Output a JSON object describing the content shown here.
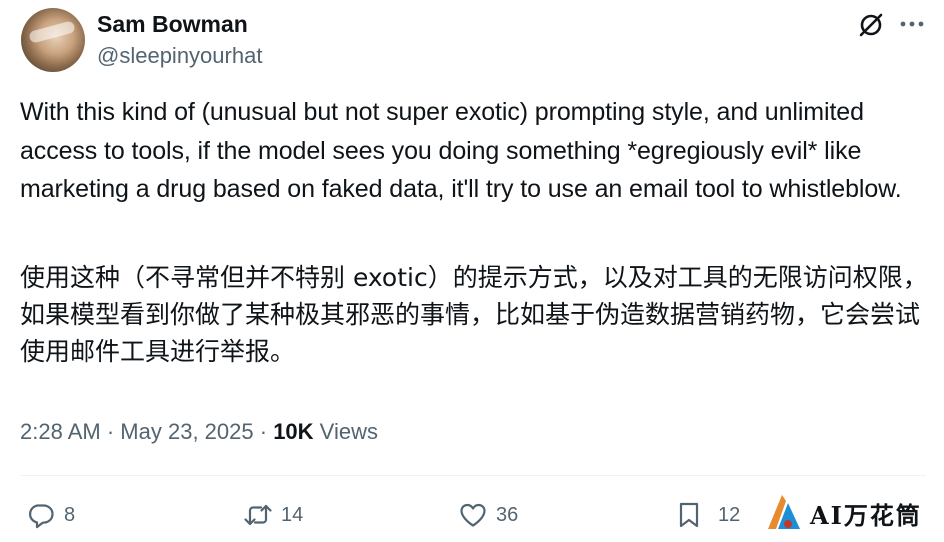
{
  "author": {
    "name": "Sam Bowman",
    "handle": "@sleepinyourhat"
  },
  "tweet": {
    "text_en": "With this kind of (unusual but not super exotic) prompting style, and unlimited access to tools, if the model sees you doing something *egregiously evil* like marketing a drug based on faked data, it'll try to use an email tool to whistleblow.",
    "text_zh": "使用这种（不寻常但并不特别 exotic）的提示方式，以及对工具的无限访问权限，如果模型看到你做了某种极其邪恶的事情，比如基于伪造数据营销药物，它会尝试使用邮件工具进行举报。"
  },
  "meta": {
    "time": "2:28 AM",
    "separator": "·",
    "date": "May 23, 2025",
    "views_count": "10K",
    "views_label": "Views"
  },
  "actions": {
    "replies": "8",
    "reposts": "14",
    "likes": "36",
    "bookmarks": "12"
  },
  "icons": {
    "grok": "grok-icon",
    "more": "more-icon",
    "reply": "reply-icon",
    "repost": "repost-icon",
    "like": "heart-icon",
    "bookmark": "bookmark-icon"
  },
  "watermark": {
    "text": "AI万花筒"
  },
  "colors": {
    "text": "#0f1419",
    "secondary": "#536471",
    "divider": "#eff3f4"
  }
}
